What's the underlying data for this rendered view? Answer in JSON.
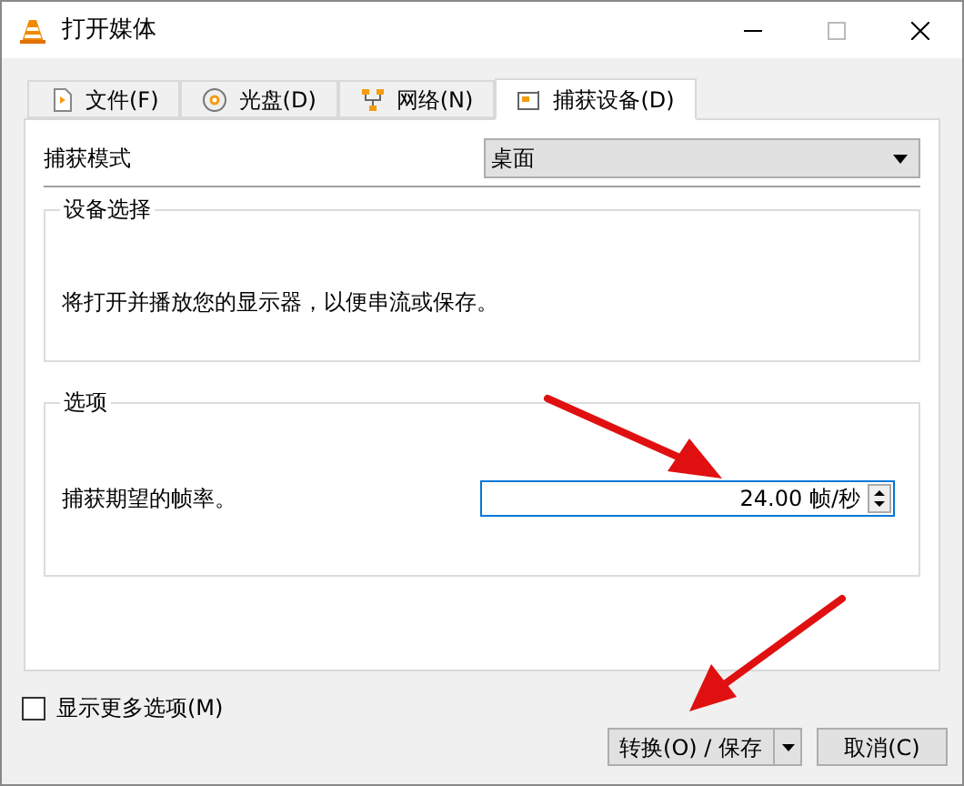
{
  "window": {
    "title": "打开媒体"
  },
  "tabs": [
    {
      "label": "文件(F)",
      "selected": false
    },
    {
      "label": "光盘(D)",
      "selected": false
    },
    {
      "label": "网络(N)",
      "selected": false
    },
    {
      "label": "捕获设备(D)",
      "selected": true
    }
  ],
  "capture_mode": {
    "label": "捕获模式",
    "value": "桌面"
  },
  "device_group": {
    "title": "设备选择",
    "text": "将打开并播放您的显示器，以便串流或保存。"
  },
  "options_group": {
    "title": "选项",
    "frame_rate": {
      "label": "捕获期望的帧率。",
      "value": "24.00 帧/秒"
    }
  },
  "more_options": {
    "label": "显示更多选项(M)",
    "checked": false
  },
  "buttons": {
    "convert": "转换(O) / 保存",
    "cancel": "取消(C)"
  }
}
